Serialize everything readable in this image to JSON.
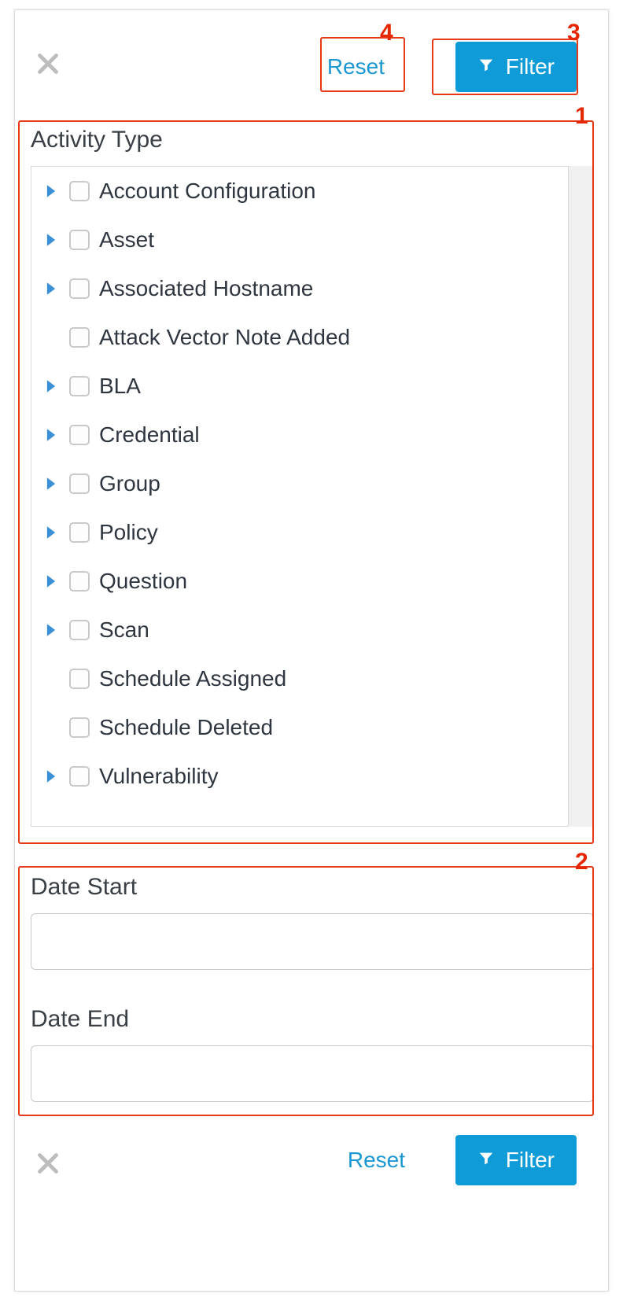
{
  "actions": {
    "reset_label": "Reset",
    "filter_label": "Filter"
  },
  "sections": {
    "activity_type_label": "Activity Type",
    "date_start_label": "Date Start",
    "date_end_label": "Date End"
  },
  "date_start_value": "",
  "date_end_value": "",
  "activity_items": [
    {
      "label": "Account Configuration",
      "expandable": true
    },
    {
      "label": "Asset",
      "expandable": true
    },
    {
      "label": "Associated Hostname",
      "expandable": true
    },
    {
      "label": "Attack Vector Note Added",
      "expandable": false
    },
    {
      "label": "BLA",
      "expandable": true
    },
    {
      "label": "Credential",
      "expandable": true
    },
    {
      "label": "Group",
      "expandable": true
    },
    {
      "label": "Policy",
      "expandable": true
    },
    {
      "label": "Question",
      "expandable": true
    },
    {
      "label": "Scan",
      "expandable": true
    },
    {
      "label": "Schedule Assigned",
      "expandable": false
    },
    {
      "label": "Schedule Deleted",
      "expandable": false
    },
    {
      "label": "Vulnerability",
      "expandable": true
    }
  ],
  "callouts": {
    "one": "1",
    "two": "2",
    "three": "3",
    "four": "4"
  }
}
